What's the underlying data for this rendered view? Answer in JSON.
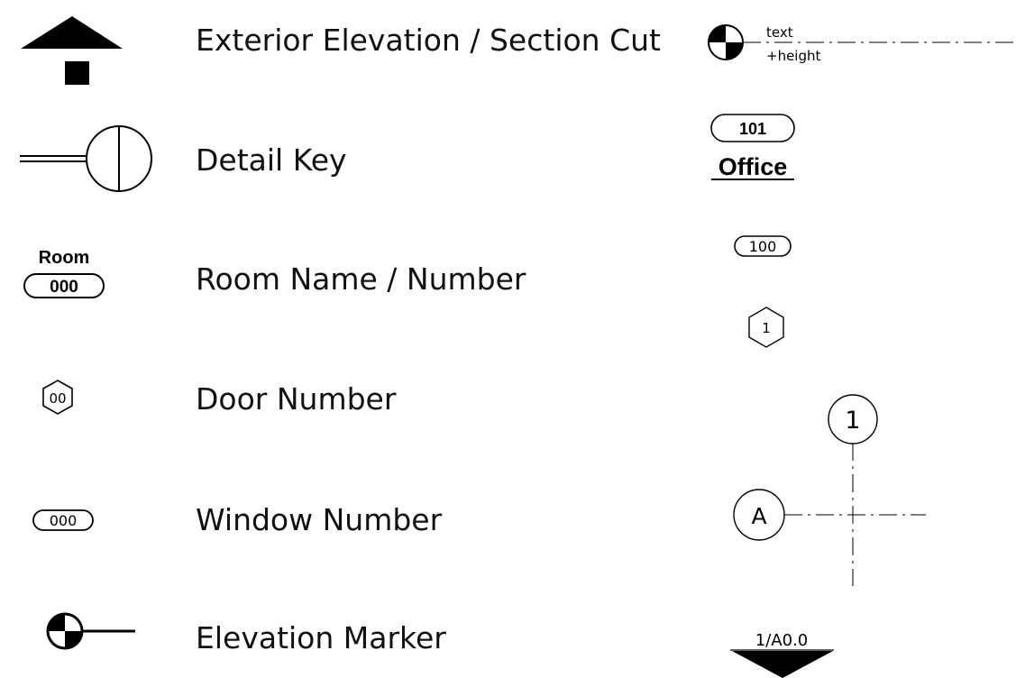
{
  "legend": {
    "items": [
      {
        "label": "Exterior Elevation / Section Cut"
      },
      {
        "label": "Detail Key"
      },
      {
        "label": "Room Name / Number"
      },
      {
        "label": "Door Number"
      },
      {
        "label": "Window Number"
      },
      {
        "label": "Elevation Marker"
      }
    ]
  },
  "symbols": {
    "room_tag": {
      "name": "Room",
      "number": "000"
    },
    "door_tag": {
      "number": "00"
    },
    "window_tag": {
      "number": "000"
    }
  },
  "examples": {
    "level_marker": {
      "text": "text",
      "height": "+height"
    },
    "room_tag": {
      "number": "101",
      "name": "Office"
    },
    "window_tag": {
      "number": "100"
    },
    "door_tag": {
      "number": "1"
    },
    "grid_column": {
      "label": "1"
    },
    "grid_row": {
      "label": "A"
    },
    "section_ref": {
      "label": "1/A0.0"
    }
  },
  "colors": {
    "ink": "#000000",
    "text": "#111111",
    "background": "#ffffff"
  }
}
